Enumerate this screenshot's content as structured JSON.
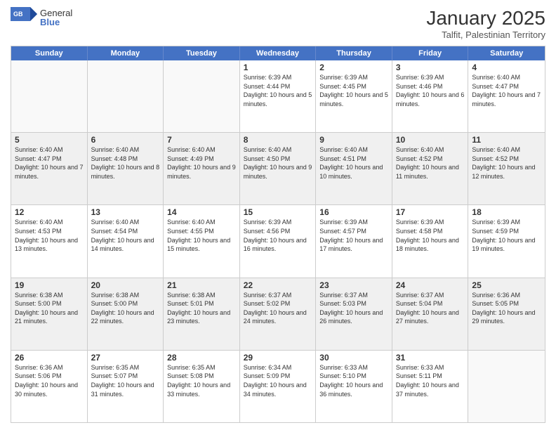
{
  "logo": {
    "general": "General",
    "blue": "Blue"
  },
  "title": "January 2025",
  "subtitle": "Talfit, Palestinian Territory",
  "weekdays": [
    "Sunday",
    "Monday",
    "Tuesday",
    "Wednesday",
    "Thursday",
    "Friday",
    "Saturday"
  ],
  "weeks": [
    [
      {
        "day": "",
        "sunrise": "",
        "sunset": "",
        "daylight": "",
        "empty": true
      },
      {
        "day": "",
        "sunrise": "",
        "sunset": "",
        "daylight": "",
        "empty": true
      },
      {
        "day": "",
        "sunrise": "",
        "sunset": "",
        "daylight": "",
        "empty": true
      },
      {
        "day": "1",
        "sunrise": "Sunrise: 6:39 AM",
        "sunset": "Sunset: 4:44 PM",
        "daylight": "Daylight: 10 hours and 5 minutes."
      },
      {
        "day": "2",
        "sunrise": "Sunrise: 6:39 AM",
        "sunset": "Sunset: 4:45 PM",
        "daylight": "Daylight: 10 hours and 5 minutes."
      },
      {
        "day": "3",
        "sunrise": "Sunrise: 6:39 AM",
        "sunset": "Sunset: 4:46 PM",
        "daylight": "Daylight: 10 hours and 6 minutes."
      },
      {
        "day": "4",
        "sunrise": "Sunrise: 6:40 AM",
        "sunset": "Sunset: 4:47 PM",
        "daylight": "Daylight: 10 hours and 7 minutes."
      }
    ],
    [
      {
        "day": "5",
        "sunrise": "Sunrise: 6:40 AM",
        "sunset": "Sunset: 4:47 PM",
        "daylight": "Daylight: 10 hours and 7 minutes."
      },
      {
        "day": "6",
        "sunrise": "Sunrise: 6:40 AM",
        "sunset": "Sunset: 4:48 PM",
        "daylight": "Daylight: 10 hours and 8 minutes."
      },
      {
        "day": "7",
        "sunrise": "Sunrise: 6:40 AM",
        "sunset": "Sunset: 4:49 PM",
        "daylight": "Daylight: 10 hours and 9 minutes."
      },
      {
        "day": "8",
        "sunrise": "Sunrise: 6:40 AM",
        "sunset": "Sunset: 4:50 PM",
        "daylight": "Daylight: 10 hours and 9 minutes."
      },
      {
        "day": "9",
        "sunrise": "Sunrise: 6:40 AM",
        "sunset": "Sunset: 4:51 PM",
        "daylight": "Daylight: 10 hours and 10 minutes."
      },
      {
        "day": "10",
        "sunrise": "Sunrise: 6:40 AM",
        "sunset": "Sunset: 4:52 PM",
        "daylight": "Daylight: 10 hours and 11 minutes."
      },
      {
        "day": "11",
        "sunrise": "Sunrise: 6:40 AM",
        "sunset": "Sunset: 4:52 PM",
        "daylight": "Daylight: 10 hours and 12 minutes."
      }
    ],
    [
      {
        "day": "12",
        "sunrise": "Sunrise: 6:40 AM",
        "sunset": "Sunset: 4:53 PM",
        "daylight": "Daylight: 10 hours and 13 minutes."
      },
      {
        "day": "13",
        "sunrise": "Sunrise: 6:40 AM",
        "sunset": "Sunset: 4:54 PM",
        "daylight": "Daylight: 10 hours and 14 minutes."
      },
      {
        "day": "14",
        "sunrise": "Sunrise: 6:40 AM",
        "sunset": "Sunset: 4:55 PM",
        "daylight": "Daylight: 10 hours and 15 minutes."
      },
      {
        "day": "15",
        "sunrise": "Sunrise: 6:39 AM",
        "sunset": "Sunset: 4:56 PM",
        "daylight": "Daylight: 10 hours and 16 minutes."
      },
      {
        "day": "16",
        "sunrise": "Sunrise: 6:39 AM",
        "sunset": "Sunset: 4:57 PM",
        "daylight": "Daylight: 10 hours and 17 minutes."
      },
      {
        "day": "17",
        "sunrise": "Sunrise: 6:39 AM",
        "sunset": "Sunset: 4:58 PM",
        "daylight": "Daylight: 10 hours and 18 minutes."
      },
      {
        "day": "18",
        "sunrise": "Sunrise: 6:39 AM",
        "sunset": "Sunset: 4:59 PM",
        "daylight": "Daylight: 10 hours and 19 minutes."
      }
    ],
    [
      {
        "day": "19",
        "sunrise": "Sunrise: 6:38 AM",
        "sunset": "Sunset: 5:00 PM",
        "daylight": "Daylight: 10 hours and 21 minutes."
      },
      {
        "day": "20",
        "sunrise": "Sunrise: 6:38 AM",
        "sunset": "Sunset: 5:00 PM",
        "daylight": "Daylight: 10 hours and 22 minutes."
      },
      {
        "day": "21",
        "sunrise": "Sunrise: 6:38 AM",
        "sunset": "Sunset: 5:01 PM",
        "daylight": "Daylight: 10 hours and 23 minutes."
      },
      {
        "day": "22",
        "sunrise": "Sunrise: 6:37 AM",
        "sunset": "Sunset: 5:02 PM",
        "daylight": "Daylight: 10 hours and 24 minutes."
      },
      {
        "day": "23",
        "sunrise": "Sunrise: 6:37 AM",
        "sunset": "Sunset: 5:03 PM",
        "daylight": "Daylight: 10 hours and 26 minutes."
      },
      {
        "day": "24",
        "sunrise": "Sunrise: 6:37 AM",
        "sunset": "Sunset: 5:04 PM",
        "daylight": "Daylight: 10 hours and 27 minutes."
      },
      {
        "day": "25",
        "sunrise": "Sunrise: 6:36 AM",
        "sunset": "Sunset: 5:05 PM",
        "daylight": "Daylight: 10 hours and 29 minutes."
      }
    ],
    [
      {
        "day": "26",
        "sunrise": "Sunrise: 6:36 AM",
        "sunset": "Sunset: 5:06 PM",
        "daylight": "Daylight: 10 hours and 30 minutes."
      },
      {
        "day": "27",
        "sunrise": "Sunrise: 6:35 AM",
        "sunset": "Sunset: 5:07 PM",
        "daylight": "Daylight: 10 hours and 31 minutes."
      },
      {
        "day": "28",
        "sunrise": "Sunrise: 6:35 AM",
        "sunset": "Sunset: 5:08 PM",
        "daylight": "Daylight: 10 hours and 33 minutes."
      },
      {
        "day": "29",
        "sunrise": "Sunrise: 6:34 AM",
        "sunset": "Sunset: 5:09 PM",
        "daylight": "Daylight: 10 hours and 34 minutes."
      },
      {
        "day": "30",
        "sunrise": "Sunrise: 6:33 AM",
        "sunset": "Sunset: 5:10 PM",
        "daylight": "Daylight: 10 hours and 36 minutes."
      },
      {
        "day": "31",
        "sunrise": "Sunrise: 6:33 AM",
        "sunset": "Sunset: 5:11 PM",
        "daylight": "Daylight: 10 hours and 37 minutes."
      },
      {
        "day": "",
        "sunrise": "",
        "sunset": "",
        "daylight": "",
        "empty": true
      }
    ]
  ]
}
